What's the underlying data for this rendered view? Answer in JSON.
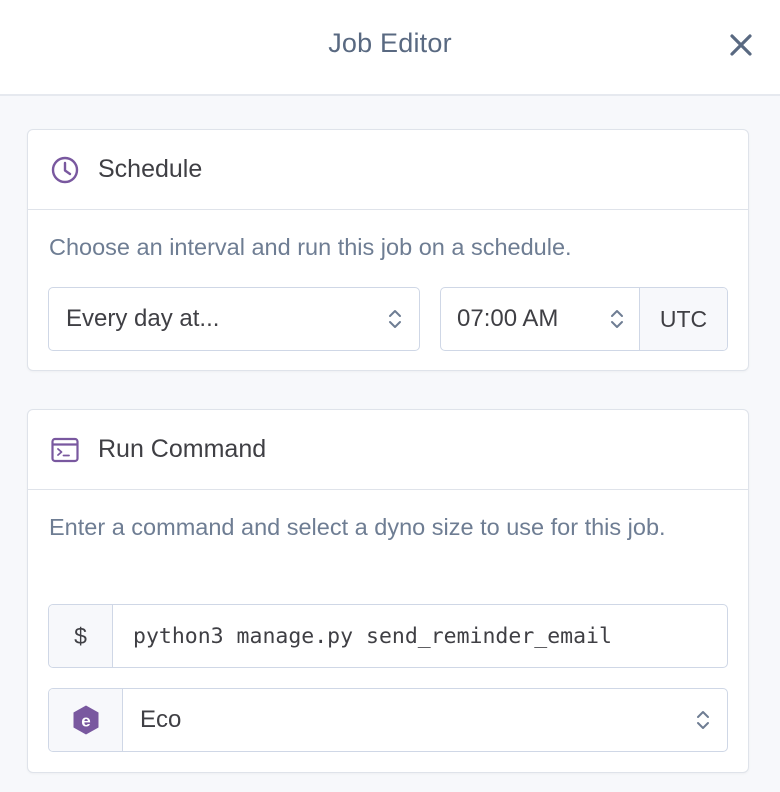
{
  "header": {
    "title": "Job Editor",
    "close_icon": "close-icon"
  },
  "schedule": {
    "icon": "clock-icon",
    "title": "Schedule",
    "description": "Choose an interval and run this job on a schedule.",
    "interval_value": "Every day at...",
    "time_value": "07:00 AM",
    "timezone": "UTC"
  },
  "run_command": {
    "icon": "terminal-icon",
    "title": "Run Command",
    "description": "Enter a command and select a dyno size to use for this job.",
    "prompt_symbol": "$",
    "command_value": "python3 manage.py send_reminder_email",
    "dyno_icon": "eco-dyno-icon",
    "dyno_letter": "e",
    "dyno_value": "Eco"
  },
  "colors": {
    "accent_purple": "#79589f",
    "text_muted": "#6e7d93",
    "border": "#cfd7e6"
  }
}
